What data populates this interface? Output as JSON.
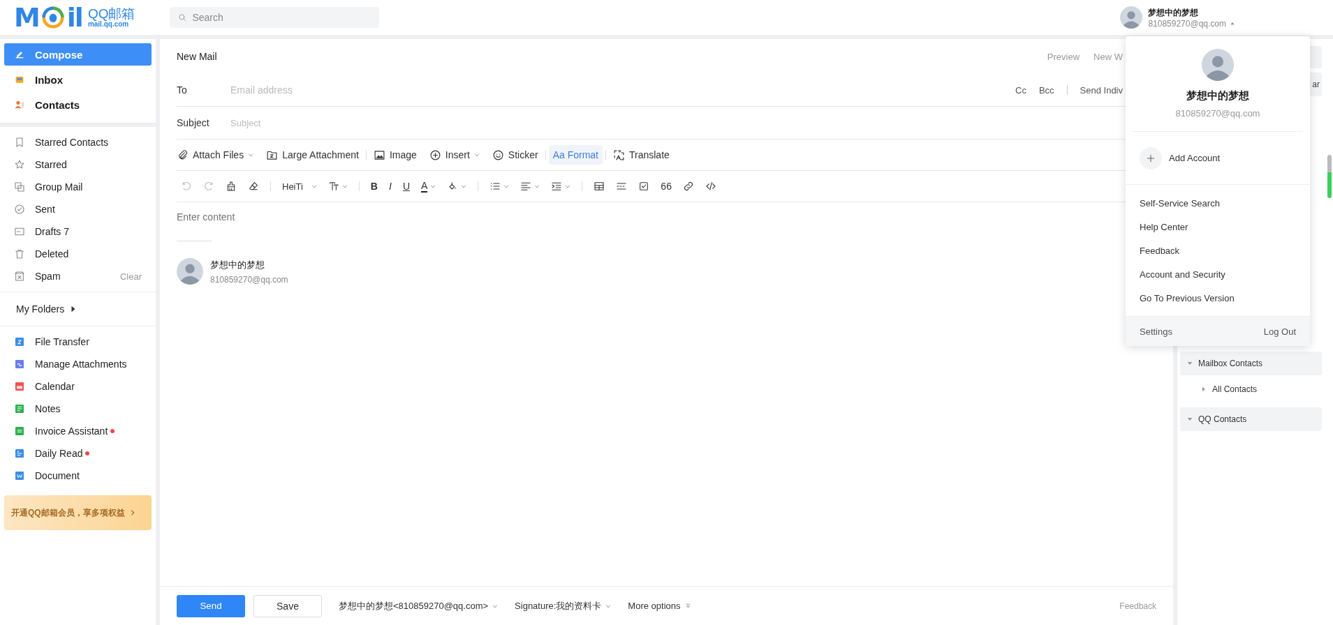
{
  "header": {
    "logo": {
      "left": "M",
      "right": "il",
      "brand": "QQ邮箱",
      "domain": "mail.qq.com"
    },
    "search": {
      "placeholder": "Search"
    },
    "account": {
      "name": "梦想中的梦想",
      "email": "810859270@qq.com",
      "expanded": true
    }
  },
  "sidebar": {
    "primary": [
      {
        "label": "Compose",
        "selected": true
      },
      {
        "label": "Inbox",
        "selected": false
      },
      {
        "label": "Contacts",
        "selected": false
      }
    ],
    "folders": [
      {
        "label": "Starred Contacts"
      },
      {
        "label": "Starred"
      },
      {
        "label": "Group Mail"
      },
      {
        "label": "Sent"
      },
      {
        "label": "Drafts 7"
      },
      {
        "label": "Deleted"
      },
      {
        "label": "Spam",
        "action": "Clear"
      }
    ],
    "my_folders": {
      "label": "My Folders",
      "expanded": false
    },
    "apps": [
      {
        "label": "File Transfer",
        "unread": false
      },
      {
        "label": "Manage Attachments",
        "unread": false
      },
      {
        "label": "Calendar",
        "unread": false
      },
      {
        "label": "Notes",
        "unread": false
      },
      {
        "label": "Invoice Assistant",
        "unread": true
      },
      {
        "label": "Daily Read",
        "unread": true
      },
      {
        "label": "Document",
        "unread": false
      }
    ],
    "promo": "开通QQ邮箱会员，享多项权益"
  },
  "compose": {
    "title": "New Mail",
    "header_actions": [
      "Preview",
      "New W"
    ],
    "to": {
      "label": "To",
      "placeholder": "Email address",
      "actions": [
        "Cc",
        "Bcc",
        "Send Indiv"
      ]
    },
    "subject": {
      "label": "Subject",
      "placeholder": "Subject"
    },
    "toolbar": [
      [
        {
          "label": "Attach Files",
          "dropdown": true,
          "selected": false
        },
        {
          "label": "Large Attachment",
          "dropdown": false,
          "selected": false
        }
      ],
      [
        {
          "label": "Image",
          "dropdown": false,
          "selected": false
        },
        {
          "label": "Insert",
          "dropdown": true,
          "selected": false
        },
        {
          "label": "Sticker",
          "dropdown": false,
          "selected": false
        }
      ],
      [
        {
          "label": "Aa Format",
          "dropdown": false,
          "selected": true
        }
      ],
      [
        {
          "label": "Translate",
          "dropdown": false,
          "selected": false
        }
      ]
    ],
    "format_bar": [
      [
        {
          "dropdown": false,
          "disabled": true
        },
        {
          "dropdown": false,
          "disabled": true
        },
        {
          "dropdown": false,
          "disabled": false
        },
        {
          "dropdown": false,
          "disabled": false
        }
      ],
      [
        {
          "label": "HeiTi",
          "dropdown": true,
          "disabled": false
        },
        {
          "dropdown": true,
          "disabled": false
        }
      ],
      [
        {
          "label": "B",
          "dropdown": false,
          "disabled": false
        },
        {
          "label": "I",
          "dropdown": false,
          "disabled": false
        },
        {
          "label": "U",
          "dropdown": false,
          "disabled": false
        },
        {
          "label": "A",
          "dropdown": true,
          "disabled": false
        },
        {
          "dropdown": true,
          "disabled": false
        }
      ],
      [
        {
          "dropdown": true,
          "disabled": false
        },
        {
          "dropdown": true,
          "disabled": false
        },
        {
          "dropdown": true,
          "disabled": false
        }
      ],
      [
        {
          "dropdown": false,
          "disabled": false
        },
        {
          "dropdown": false,
          "disabled": false
        },
        {
          "dropdown": false,
          "disabled": false
        },
        {
          "label": "66",
          "dropdown": false,
          "disabled": false
        },
        {
          "dropdown": false,
          "disabled": false
        },
        {
          "dropdown": false,
          "disabled": false
        }
      ]
    ],
    "body_placeholder": "Enter content",
    "signature": {
      "name": "梦想中的梦想",
      "email": "810859270@qq.com"
    },
    "footer": {
      "send": "Send",
      "save": "Save",
      "sender": "梦想中的梦想<810859270@qq.com>",
      "signature": "Signature:我的资料卡",
      "more": "More options",
      "feedback": "Feedback"
    }
  },
  "right_panel": {
    "button": "ar",
    "tree": [
      {
        "label": "Mailbox Contacts",
        "expanded": true,
        "children": [
          {
            "label": "All Contacts",
            "expanded": false
          }
        ]
      },
      {
        "label": "QQ Contacts",
        "expanded": true
      }
    ]
  },
  "account_menu": {
    "name": "梦想中的梦想",
    "email": "810859270@qq.com",
    "add": "Add Account",
    "items": [
      "Self-Service Search",
      "Help Center",
      "Feedback",
      "Account and Security",
      "Go To Previous Version"
    ],
    "footer": {
      "settings": "Settings",
      "logout": "Log Out"
    }
  }
}
